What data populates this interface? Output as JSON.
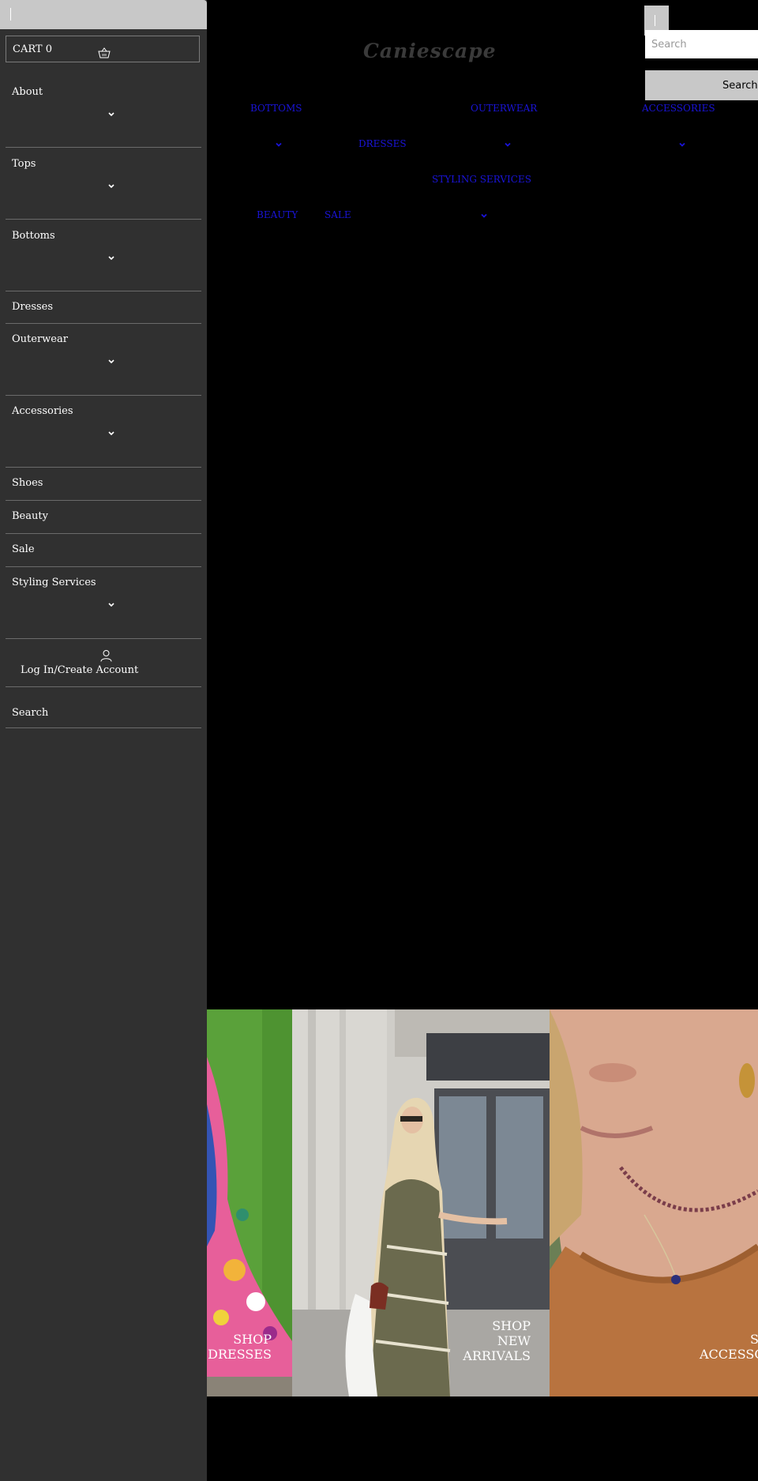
{
  "drawer": {
    "cart": {
      "label": "CART",
      "count": "0"
    },
    "items": [
      {
        "label": "About",
        "expandable": true
      },
      {
        "label": "Tops",
        "expandable": true
      },
      {
        "label": "Bottoms",
        "expandable": true
      },
      {
        "label": "Dresses",
        "expandable": false
      },
      {
        "label": "Outerwear",
        "expandable": true
      },
      {
        "label": "Accessories",
        "expandable": true
      },
      {
        "label": "Shoes",
        "expandable": false
      },
      {
        "label": "Beauty",
        "expandable": false
      },
      {
        "label": "Sale",
        "expandable": false
      },
      {
        "label": "Styling Services",
        "expandable": true
      }
    ],
    "account": {
      "label": "Log In/Create Account",
      "icon": "user-icon"
    },
    "search_label": "Search"
  },
  "header": {
    "logo": "Caniescape",
    "search": {
      "placeholder": "Search",
      "button_label": "Search"
    }
  },
  "top_nav": {
    "bottoms": "Bottoms",
    "dresses": "Dresses",
    "outerwear": "Outerwear",
    "accessories": "Accessories",
    "styling_services": "Styling Services",
    "beauty": "Beauty",
    "sale": "Sale"
  },
  "banner": {
    "dresses": {
      "line1": "Shop",
      "line2": "Dresses"
    },
    "new_arrivals": {
      "line1": "Shop",
      "line2": "New",
      "line3": "Arrivals"
    },
    "accessories": {
      "line1": "Shop",
      "line2": "Accessories"
    }
  },
  "colors": {
    "drawer_bg": "#303030",
    "page_bg": "#000000",
    "link": "#1a14d8",
    "button_grey": "#c8c8c8"
  }
}
